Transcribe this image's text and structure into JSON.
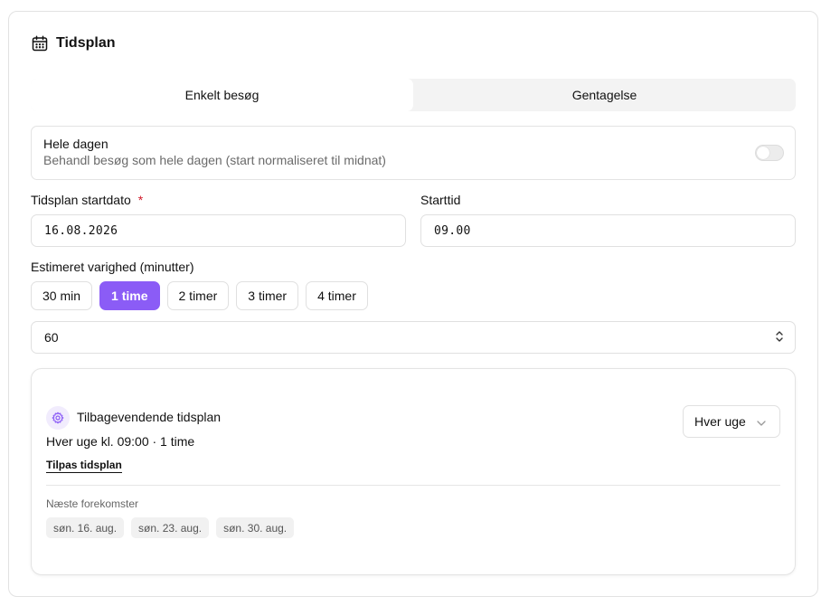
{
  "card": {
    "title": "Tidsplan",
    "title_icon": "calendar-icon"
  },
  "tabs": [
    {
      "label": "Enkelt besøg",
      "active": true
    },
    {
      "label": "Gentagelse",
      "active": false
    }
  ],
  "all_day": {
    "label": "Hele dagen",
    "description": "Behandl besøg som hele dagen (start normaliseret til midnat)",
    "enabled": false
  },
  "start_date": {
    "label": "Tidsplan startdato",
    "required_mark": "*",
    "value": "16.08.2026"
  },
  "start_time": {
    "label": "Starttid",
    "value": "09.00"
  },
  "duration": {
    "label": "Estimeret varighed (minutter)",
    "presets": [
      {
        "label": "30 min",
        "active": false
      },
      {
        "label": "1 time",
        "active": true
      },
      {
        "label": "2 timer",
        "active": false
      },
      {
        "label": "3 timer",
        "active": false
      },
      {
        "label": "4 timer",
        "active": false
      }
    ],
    "value": "60"
  },
  "recurrence": {
    "title": "Tilbagevendende tidsplan",
    "summary": "Hver uge kl. 09:00 · 1 time",
    "customize_link": "Tilpas tidsplan",
    "frequency": "Hver uge",
    "next_label": "Næste forekomster",
    "occurrences": [
      "søn. 16. aug.",
      "søn. 23. aug.",
      "søn. 30. aug."
    ]
  },
  "colors": {
    "accent": "#8b5cf6",
    "accent_light": "#f1ecfd",
    "required": "#d11a2a",
    "border": "#e0e0e0"
  }
}
